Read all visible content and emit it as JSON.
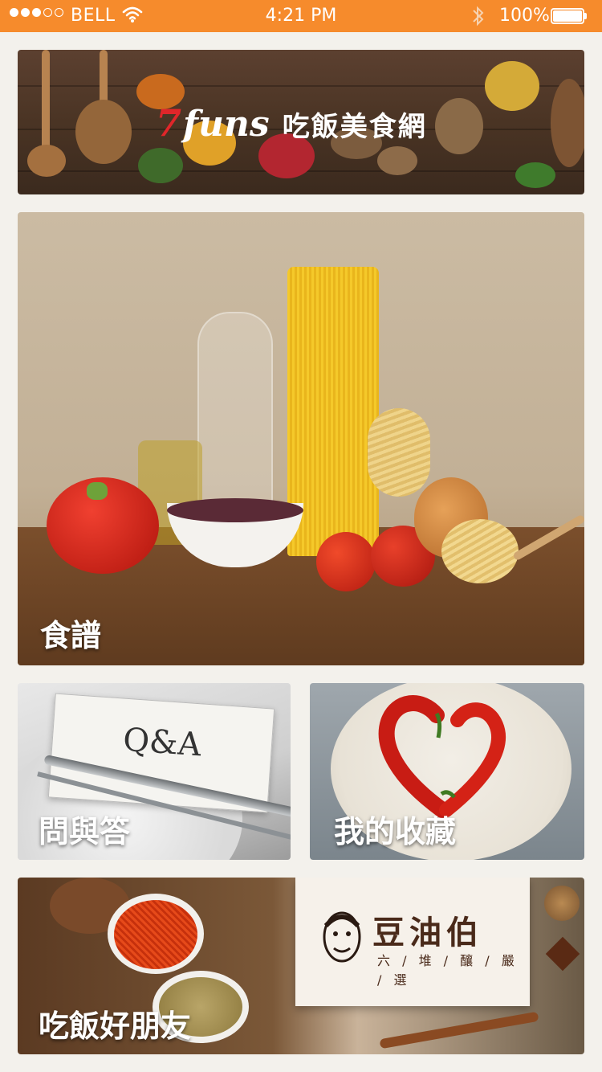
{
  "status_bar": {
    "carrier": "BELL",
    "time": "4:21 PM",
    "battery": "100%",
    "signal_bars_filled": 3,
    "signal_bars_total": 5
  },
  "banner": {
    "logo_number": "7",
    "logo_word": "funs",
    "site_name": "吃飯美食網"
  },
  "tiles": {
    "recipes": "食譜",
    "qa": "問與答",
    "qa_card_text": "Q&A",
    "favorites": "我的收藏",
    "friends": "吃飯好朋友",
    "friends_brand_name": "豆油伯",
    "friends_brand_tagline": "六 / 堆 / 釀 / 嚴 / 選"
  },
  "colors": {
    "status_bar_bg": "#f68b2c",
    "logo_red": "#e0262a",
    "page_bg": "#f3f1ec"
  },
  "icons": [
    "wifi-icon",
    "bluetooth-icon",
    "battery-icon",
    "signal-icon"
  ]
}
